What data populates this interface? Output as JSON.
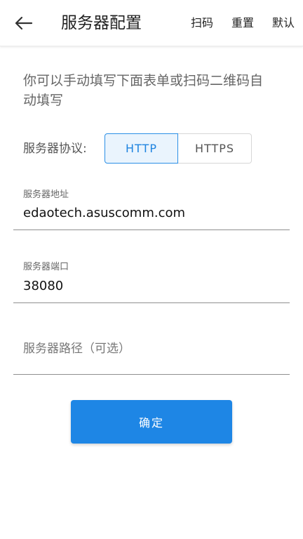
{
  "header": {
    "title": "服务器配置",
    "actions": {
      "scan": "扫码",
      "reset": "重置",
      "default": "默认"
    }
  },
  "intro": "你可以手动填写下面表单或扫码二维码自动填写",
  "protocol": {
    "label": "服务器协议:",
    "options": [
      "HTTP",
      "HTTPS"
    ],
    "selected": "HTTP"
  },
  "fields": {
    "address": {
      "label": "服务器地址",
      "value": "edaotech.asuscomm.com"
    },
    "port": {
      "label": "服务器端口",
      "value": "38080"
    },
    "path": {
      "placeholder": "服务器路径（可选）",
      "value": ""
    }
  },
  "confirm_label": "确定",
  "colors": {
    "accent": "#1e86e5",
    "selected_bg": "#eaf4fd"
  },
  "icons": {
    "back": "arrow-left-icon"
  }
}
